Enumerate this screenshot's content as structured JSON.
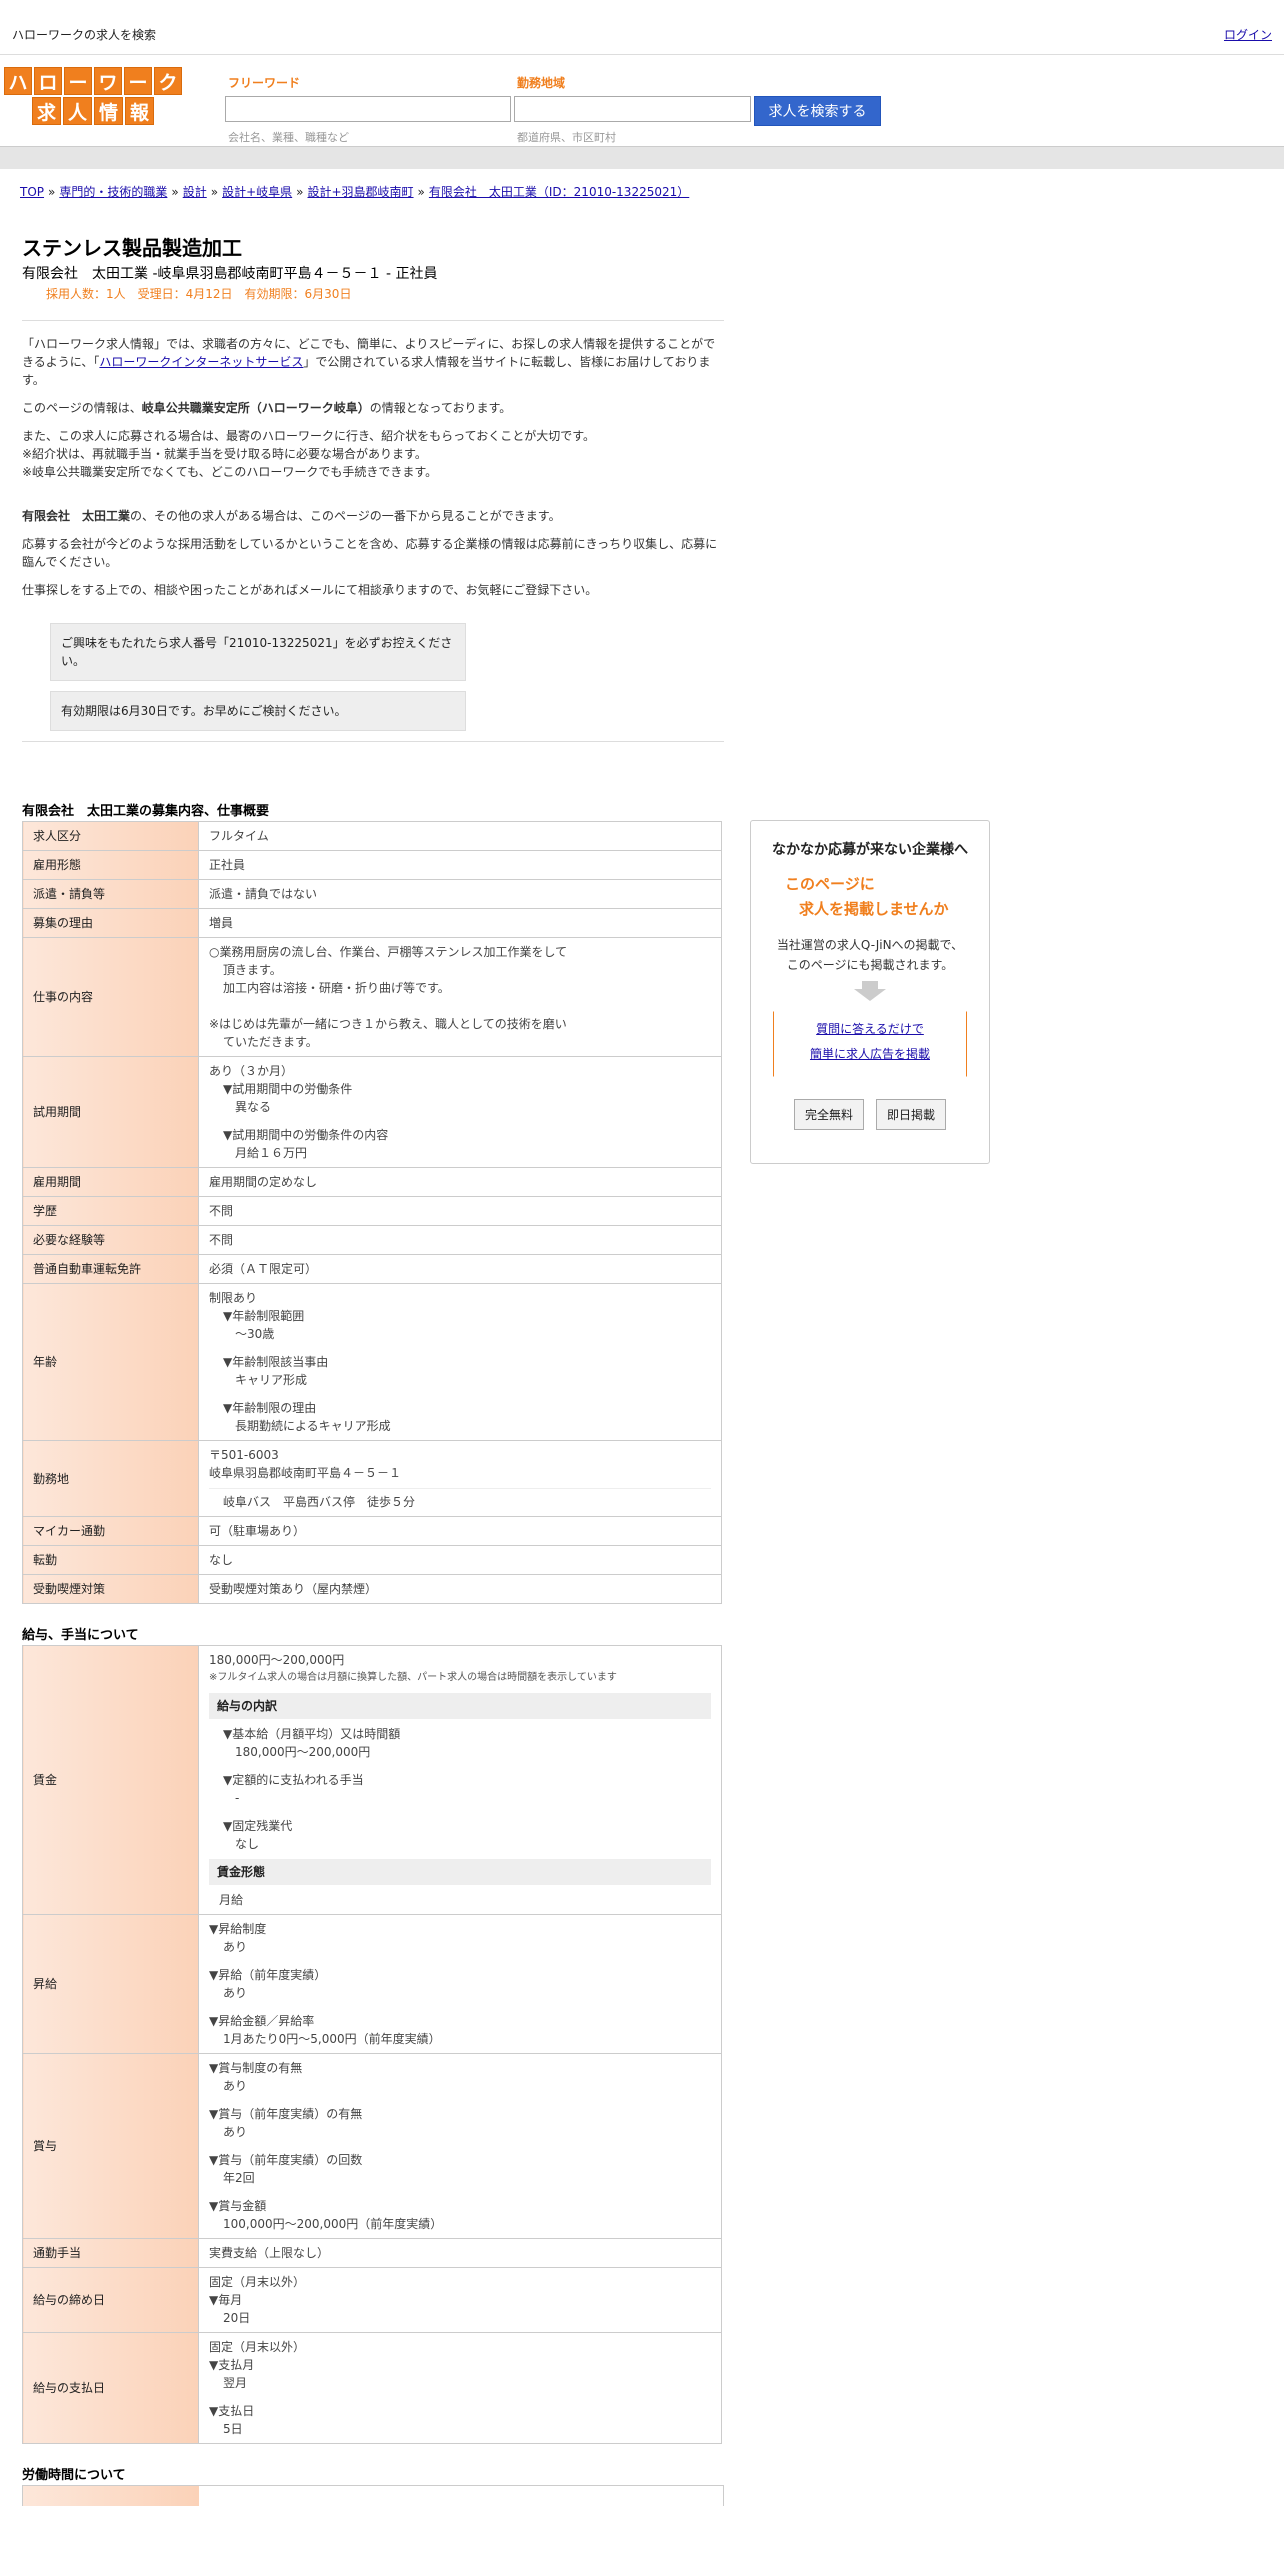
{
  "topbar": {
    "title": "ハローワークの求人を検索",
    "login": "ログイン"
  },
  "logo": {
    "row1": [
      "ハ",
      "ロ",
      "ー",
      "ワ",
      "ー",
      "ク"
    ],
    "row2": [
      "求",
      "人",
      "情",
      "報"
    ]
  },
  "search": {
    "freeword_label": "フリーワード",
    "freeword_hint": "会社名、業種、職種など",
    "area_label": "勤務地域",
    "area_hint": "都道府県、市区町村",
    "button": "求人を検索する"
  },
  "breadcrumb": [
    "TOP",
    "専門的・技術的職業",
    "設計",
    "設計+岐阜県",
    "設計+羽島郡岐南町",
    "有限会社　太田工業（ID：21010-13225021）"
  ],
  "job": {
    "title": "ステンレス製品製造加工",
    "company_line": "有限会社　太田工業 -岐阜県羽島郡岐南町平島４－５－１ - 正社員",
    "meta": "採用人数：1人　受理日：4月12日　有効期限：6月30日"
  },
  "intro": {
    "p1_a": "「ハローワーク求人情報」では、求職者の方々に、どこでも、簡単に、よりスピーディに、お探しの求人情報を提供することができるように、「",
    "p1_link": "ハローワークインターネットサービス",
    "p1_b": "」で公開されている求人情報を当サイトに転載し、皆様にお届けしております。",
    "p2_a": "このページの情報は、",
    "p2_bold": "岐阜公共職業安定所（ハローワーク岐阜）",
    "p2_b": "の情報となっております。",
    "p3": "また、この求人に応募される場合は、最寄のハローワークに行き、紹介状をもらっておくことが大切です。",
    "p3b": "※紹介状は、再就職手当・就業手当を受け取る時に必要な場合があります。",
    "p3c": "※岐阜公共職業安定所でなくても、どこのハローワークでも手続きできます。",
    "p4_bold": "有限会社　太田工業",
    "p4": "の、その他の求人がある場合は、このページの一番下から見ることができます。",
    "p5": "応募する会社が今どのような採用活動をしているかということを含め、応募する企業様の情報は応募前にきっちり収集し、応募に臨んでください。",
    "p6": "仕事探しをする上での、相談や困ったことがあればメールにて相談承りますので、お気軽にご登録下さい。",
    "notice1": "ご興味をもたれたら求人番号「21010-13225021」を必ずお控えください。",
    "notice2": "有効期限は6月30日です。お早めにご検討ください。"
  },
  "section1": {
    "title": "有限会社　太田工業の募集内容、仕事概要",
    "rows": {
      "kubun": {
        "k": "求人区分",
        "v": "フルタイム"
      },
      "koyo": {
        "k": "雇用形態",
        "v": "正社員"
      },
      "haken": {
        "k": "派遣・請負等",
        "v": "派遣・請負ではない"
      },
      "riyu": {
        "k": "募集の理由",
        "v": "増員"
      },
      "naiyo": {
        "k": "仕事の内容",
        "l1": "○業務用厨房の流し台、作業台、戸棚等ステンレス加工作業をして",
        "l2": "頂きます。",
        "l3": "加工内容は溶接・研磨・折り曲げ等です。",
        "l4": "※はじめは先輩が一緒につき１から教え、職人としての技術を磨い",
        "l5": "ていただきます。"
      },
      "shiyo": {
        "k": "試用期間",
        "l1": "あり（３か月）",
        "l2": "▼試用期間中の労働条件",
        "l3": "異なる",
        "l4": "▼試用期間中の労働条件の内容",
        "l5": "月給１６万円"
      },
      "kikan": {
        "k": "雇用期間",
        "v": "雇用期間の定めなし"
      },
      "gakureki": {
        "k": "学歴",
        "v": "不問"
      },
      "keiken": {
        "k": "必要な経験等",
        "v": "不問"
      },
      "menkyo": {
        "k": "普通自動車運転免許",
        "v": "必須（ＡＴ限定可）"
      },
      "nenrei": {
        "k": "年齢",
        "l1": "制限あり",
        "l2": "▼年齢制限範囲",
        "l3": "〜30歳",
        "l4": "▼年齢制限該当事由",
        "l5": "キャリア形成",
        "l6": "▼年齢制限の理由",
        "l7": "長期勤続によるキャリア形成"
      },
      "kinmu": {
        "k": "勤務地",
        "l1": "〒501-6003",
        "l2": "岐阜県羽島郡岐南町平島４－５－１",
        "l3": "岐阜バス　平島西バス停　徒歩５分"
      },
      "mycar": {
        "k": "マイカー通勤",
        "v": "可（駐車場あり）"
      },
      "tenkin": {
        "k": "転勤",
        "v": "なし"
      },
      "kitsuen": {
        "k": "受動喫煙対策",
        "v": "受動喫煙対策あり（屋内禁煙）"
      }
    }
  },
  "section2": {
    "title": "給与、手当について",
    "chingin": {
      "k": "賃金",
      "range": "180,000円〜200,000円",
      "note": "※フルタイム求人の場合は月額に換算した額、パート求人の場合は時間額を表示しています",
      "breakdown_head": "給与の内訳",
      "b1": "▼基本給（月額平均）又は時間額",
      "b1v": "180,000円〜200,000円",
      "b2": "▼定額的に支払われる手当",
      "b2v": "-",
      "b3": "▼固定残業代",
      "b3v": "なし",
      "form_head": "賃金形態",
      "form": "月給"
    },
    "shokyu": {
      "k": "昇給",
      "l1": "▼昇給制度",
      "l1v": "あり",
      "l2": "▼昇給（前年度実績）",
      "l2v": "あり",
      "l3": "▼昇給金額／昇給率",
      "l3v": "1月あたり0円〜5,000円（前年度実績）"
    },
    "shoyo": {
      "k": "賞与",
      "l1": "▼賞与制度の有無",
      "l1v": "あり",
      "l2": "▼賞与（前年度実績）の有無",
      "l2v": "あり",
      "l3": "▼賞与（前年度実績）の回数",
      "l3v": "年2回",
      "l4": "▼賞与金額",
      "l4v": "100,000円〜200,000円（前年度実績）"
    },
    "tsukin": {
      "k": "通勤手当",
      "v": "実費支給（上限なし）"
    },
    "shime": {
      "k": "給与の締め日",
      "l1": "固定（月末以外）",
      "l2": "▼毎月",
      "l2v": "20日"
    },
    "shiharai": {
      "k": "給与の支払日",
      "l1": "固定（月末以外）",
      "l2": "▼支払月",
      "l2v": "翌月",
      "l3": "▼支払日",
      "l3v": "5日"
    }
  },
  "section3": {
    "title": "労働時間について"
  },
  "sidebox": {
    "heading": "なかなか応募が来ない企業様へ",
    "orange1": "このページに",
    "orange2": "求人を掲載しませんか",
    "desc1": "当社運営の求人Q-JiNへの掲載で、",
    "desc2": "このページにも掲載されます。",
    "link1": "質問に答えるだけで",
    "link2": "簡単に求人広告を掲載",
    "btn1": "完全無料",
    "btn2": "即日掲載"
  }
}
